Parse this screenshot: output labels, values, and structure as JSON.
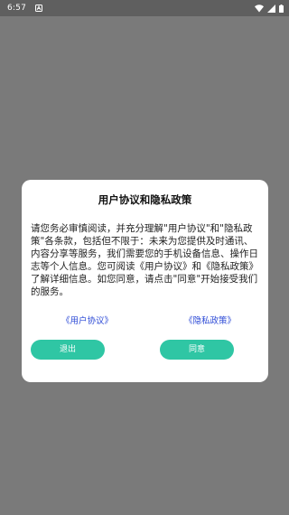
{
  "status_bar": {
    "time": "6:57",
    "notification_icon": "a-notification-icon",
    "wifi_icon": "wifi-icon",
    "signal_icon": "signal-icon",
    "battery_icon": "battery-icon"
  },
  "dialog": {
    "title": "用户协议和隐私政策",
    "body": "请您务必审慎阅读，并充分理解\"用户协议\"和\"隐私政策\"各条款，包括但不限于：未来为您提供及时通讯、内容分享等服务，我们需要您的手机设备信息、操作日志等个人信息。您可阅读《用户协议》和《隐私政策》了解详细信息。如您同意，请点击\"同意\"开始接受我们的服务。",
    "link_user_agreement": "《用户协议》",
    "link_privacy_policy": "《隐私政策》",
    "exit_button": "退出",
    "agree_button": "同意"
  },
  "colors": {
    "overlay": "#7a7a7a",
    "status_bar": "#5f5f5f",
    "accent_button": "#2fc6a4",
    "link": "#2b49d6"
  }
}
